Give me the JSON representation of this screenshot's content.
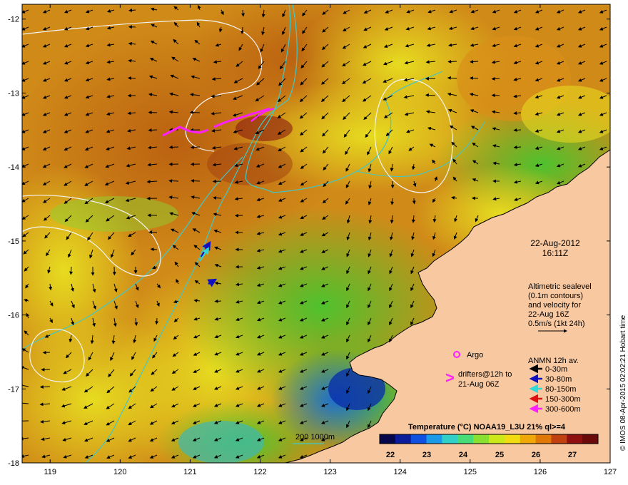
{
  "map": {
    "lon_range": [
      118.6,
      127
    ],
    "lat_range": [
      -18,
      -11.8
    ],
    "x_ticks": [
      "119",
      "120",
      "121",
      "122",
      "123",
      "124",
      "125",
      "126",
      "127"
    ],
    "y_ticks": [
      "-12",
      "-13",
      "-14",
      "-15",
      "-16",
      "-17",
      "-18"
    ]
  },
  "info": {
    "date": "22-Aug-2012",
    "time": "16:11Z",
    "altimetry_lines": [
      "Altimetric sealevel",
      "(0.1m contours)",
      "and velocity for",
      "22-Aug 16Z",
      "0.5m/s (1kt 24h)"
    ]
  },
  "legend": {
    "argo_label": "Argo",
    "drifters_lines": [
      "drifters@12h to",
      "21-Aug 06Z"
    ],
    "drifter_symbol": ">",
    "anmn_title": "ANMN 12h av.",
    "depths": [
      {
        "label": "0-30m",
        "color": "#000000"
      },
      {
        "label": "30-80m",
        "color": "#1010c0"
      },
      {
        "label": "80-150m",
        "color": "#30d8d8"
      },
      {
        "label": "150-300m",
        "color": "#e01010"
      },
      {
        "label": "300-600m",
        "color": "#ff20ff"
      }
    ]
  },
  "isobath": {
    "label": "200  1000m",
    "color": "#40c8c8"
  },
  "colorbar": {
    "title": "Temperature (°C) NOAA19_L3U 21% ql>=4",
    "ticks": [
      "22",
      "23",
      "24",
      "25",
      "26",
      "27"
    ],
    "colors": [
      "#06064a",
      "#0a1c9a",
      "#1050e0",
      "#1c9ae8",
      "#30d0c8",
      "#48dc78",
      "#8ae030",
      "#cce818",
      "#f0dc10",
      "#f0a808",
      "#e07808",
      "#c04010",
      "#901010",
      "#6a0a0a"
    ]
  },
  "credit": "© IMOS 08-Apr-2015 02:02:21 Hobart time",
  "colors": {
    "land": "#f8c8a0",
    "coast": "#000000",
    "frame": "#000000"
  }
}
